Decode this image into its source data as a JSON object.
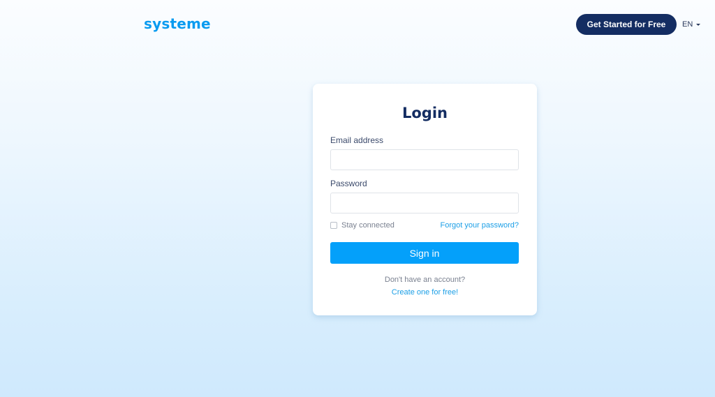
{
  "header": {
    "logo": "systeme",
    "cta_label": "Get Started for Free",
    "language": "EN"
  },
  "login": {
    "title": "Login",
    "email_label": "Email address",
    "email_value": "",
    "password_label": "Password",
    "password_value": "",
    "stay_connected_label": "Stay connected",
    "stay_connected_checked": false,
    "forgot_password_label": "Forgot your password?",
    "sign_in_label": "Sign in",
    "no_account_text": "Don't have an account?",
    "create_account_label": "Create one for free!"
  },
  "colors": {
    "brand": "#0a9bf0",
    "navy": "#142d62",
    "primary_button": "#04a0fa",
    "link": "#1a9ee6"
  }
}
